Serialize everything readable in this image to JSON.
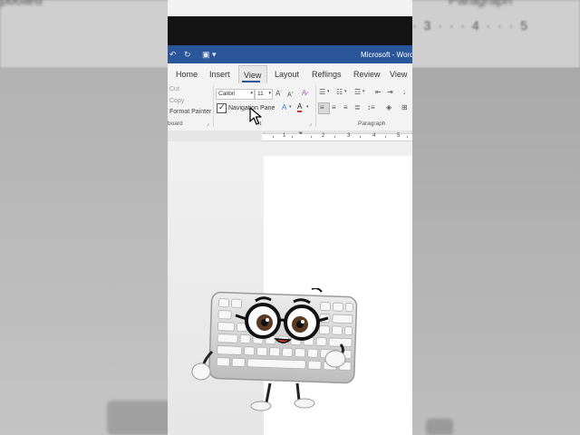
{
  "background": {
    "left_text": "pboard",
    "right_text": "Paragraph",
    "ruler_text": "· 3 · · · 4 · · · 5"
  },
  "window": {
    "title": "Microsoft - Word",
    "accent": "#2b579a"
  },
  "tabs": [
    "Home",
    "Insert",
    "View",
    "Layout",
    "Reflings",
    "Review",
    "View"
  ],
  "active_tab": "View",
  "clipboard": {
    "cut_label": "Cut",
    "copy_label": "Copy",
    "format_painter_label": "Format Painter",
    "group_label": "board"
  },
  "font": {
    "name": "Calibri",
    "size": "11",
    "group_label": "nt"
  },
  "navigation_pane": {
    "label": "Navigation Pane",
    "checked": true
  },
  "paragraph": {
    "group_label": "Paragraph"
  },
  "ruler": {
    "numbers": [
      "1",
      "1",
      "2",
      "3",
      "4",
      "5"
    ]
  },
  "icons": [
    "undo-icon",
    "redo-icon",
    "customize-quick-access-icon",
    "grow-font-icon",
    "shrink-font-icon",
    "clear-formatting-icon",
    "bullets-icon",
    "numbering-icon",
    "multilevel-list-icon",
    "decrease-indent-icon",
    "increase-indent-icon",
    "align-left-icon",
    "center-icon",
    "align-right-icon",
    "justify-icon",
    "line-spacing-icon",
    "shading-icon",
    "borders-icon",
    "text-effects-icon",
    "font-color-icon",
    "mouse-pointer-icon"
  ],
  "colors": {
    "font_color_red": "#d32f2f",
    "text_effects_blue": "#3a7bd5"
  }
}
